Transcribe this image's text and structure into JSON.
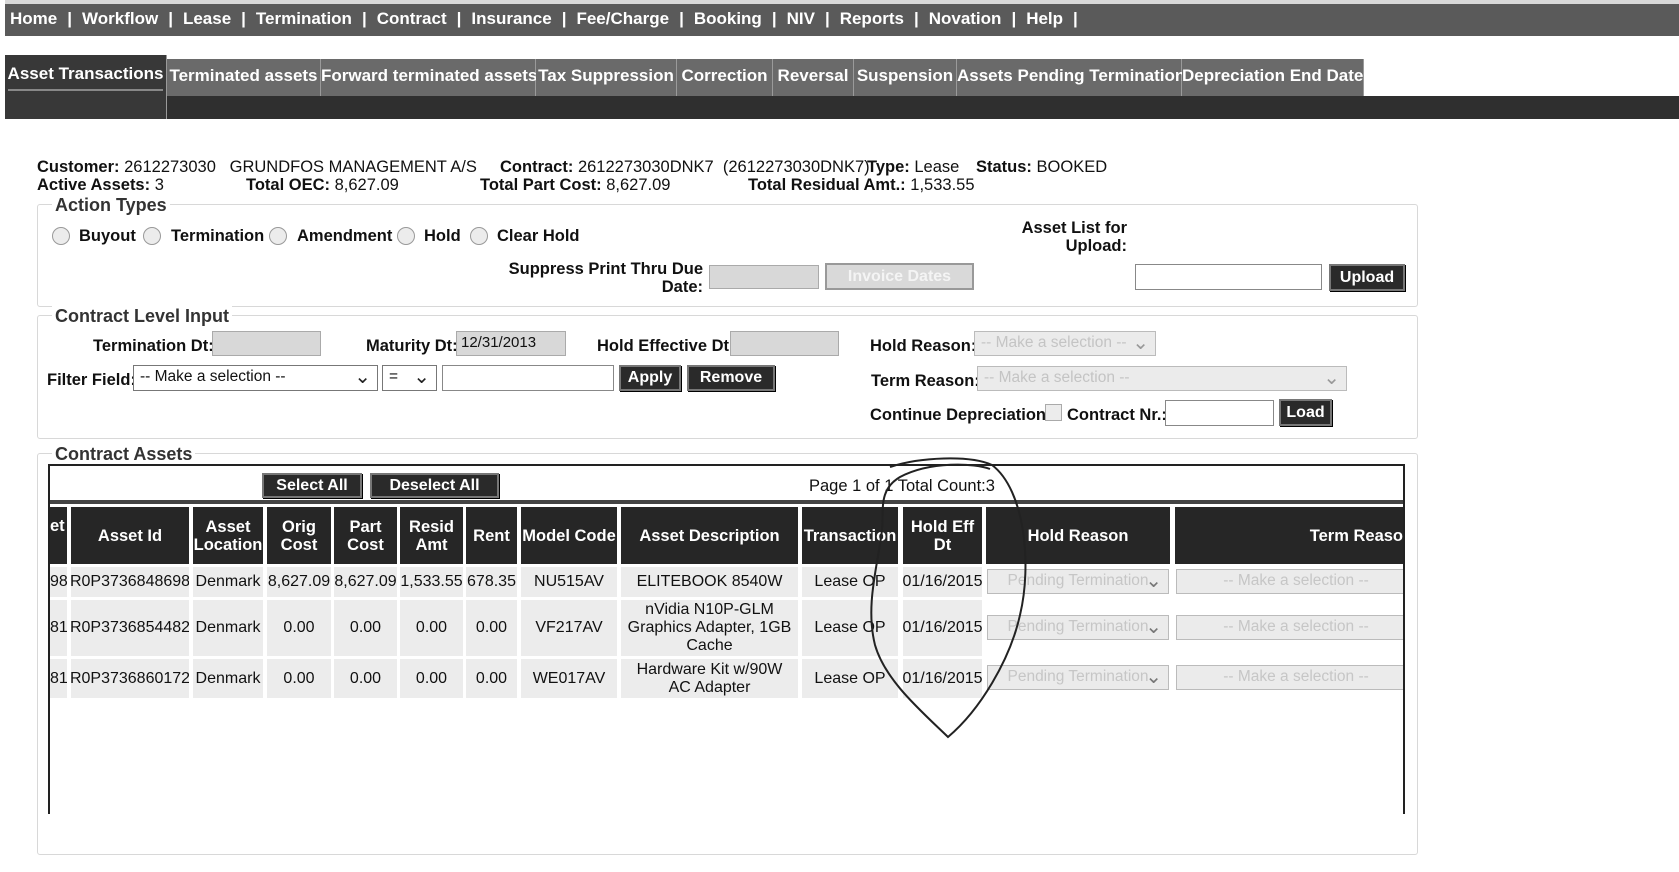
{
  "menu": [
    "Home",
    "Workflow",
    "Lease",
    "Termination",
    "Contract",
    "Insurance",
    "Fee/Charge",
    "Booking",
    "NIV",
    "Reports",
    "Novation",
    "Help"
  ],
  "tabs": [
    "Asset Transactions",
    "Terminated assets",
    "Forward terminated assets",
    "Tax Suppression",
    "Correction",
    "Reversal",
    "Suspension",
    "Assets Pending Termination",
    "Depreciation End Date"
  ],
  "info": {
    "customer_label": "Customer:",
    "customer_value": "2612273030   GRUNDFOS MANAGEMENT A/S",
    "contract_label": "Contract:",
    "contract_value": "2612273030DNK7  (2612273030DNK7)",
    "type_label": "Type:",
    "type_value": "Lease",
    "status_label": "Status:",
    "status_value": "BOOKED",
    "active_label": "Active Assets:",
    "active_value": "3",
    "oec_label": "Total OEC:",
    "oec_value": "8,627.09",
    "partcost_label": "Total Part Cost:",
    "partcost_value": "8,627.09",
    "residual_label": "Total Residual Amt.:",
    "residual_value": "1,533.55"
  },
  "action_types": {
    "legend": "Action Types",
    "options": [
      "Buyout",
      "Termination",
      "Amendment",
      "Hold",
      "Clear Hold"
    ],
    "suppress_label_1": "Suppress Print Thru Due",
    "suppress_label_2": "Date:",
    "invoice_dates_button": "Invoice Dates",
    "asset_list_label_1": "Asset List for",
    "asset_list_label_2": "Upload:",
    "upload_button": "Upload"
  },
  "contract_level": {
    "legend": "Contract Level Input",
    "termination_dt_label": "Termination Dt:",
    "maturity_dt_label": "Maturity Dt:",
    "maturity_dt_value": "12/31/2013",
    "hold_effective_label": "Hold Effective Dt:",
    "hold_reason_label": "Hold Reason:",
    "hold_reason_value": "-- Make a selection --",
    "filter_field_label": "Filter Field:",
    "filter_field_value": "-- Make a selection --",
    "operator_value": "=",
    "apply_button": "Apply",
    "remove_button": "Remove",
    "term_reason_label": "Term Reason:",
    "term_reason_value": "-- Make a selection --",
    "continue_depr_label": "Continue Depreciation",
    "contract_nr_label": "Contract Nr.:",
    "load_button": "Load"
  },
  "contract_assets": {
    "legend": "Contract Assets",
    "select_all": "Select All",
    "deselect_all": "Deselect All",
    "paging": "Page 1 of 1 Total Count:3",
    "columns": [
      "et",
      "Asset Id",
      "Asset Location",
      "Orig Cost",
      "Part Cost",
      "Resid Amt",
      "Rent",
      "Model Code",
      "Asset Description",
      "Transaction",
      "Hold Eff Dt",
      "Hold Reason",
      "Term Reaso"
    ],
    "rows": [
      {
        "c0": "98",
        "asset_id": "R0P3736848698",
        "location": "Denmark",
        "orig_cost": "8,627.09",
        "part_cost": "8,627.09",
        "resid_amt": "1,533.55",
        "rent": "678.35",
        "model_code": "NU515AV",
        "description": "ELITEBOOK 8540W",
        "transaction": "Lease OP",
        "hold_eff_dt": "01/16/2015",
        "hold_reason": "Pending Termination",
        "term_reason": "-- Make a selection --"
      },
      {
        "c0": "81",
        "asset_id": "R0P3736854482",
        "location": "Denmark",
        "orig_cost": "0.00",
        "part_cost": "0.00",
        "resid_amt": "0.00",
        "rent": "0.00",
        "model_code": "VF217AV",
        "description": "nVidia N10P-GLM Graphics Adapter, 1GB Cache",
        "transaction": "Lease OP",
        "hold_eff_dt": "01/16/2015",
        "hold_reason": "Pending Termination",
        "term_reason": "-- Make a selection --"
      },
      {
        "c0": "81",
        "asset_id": "R0P3736860172",
        "location": "Denmark",
        "orig_cost": "0.00",
        "part_cost": "0.00",
        "resid_amt": "0.00",
        "rent": "0.00",
        "model_code": "WE017AV",
        "description": "Hardware Kit w/90W AC Adapter",
        "transaction": "Lease OP",
        "hold_eff_dt": "01/16/2015",
        "hold_reason": "Pending Termination",
        "term_reason": "-- Make a selection --"
      }
    ]
  },
  "colors": {
    "menu_bg": "#5a5a5a",
    "tab_bg": "#6a6a6a",
    "tab_active_bg": "#383838",
    "header_bg": "#262626",
    "row_bg": "#ececec"
  },
  "icons": {
    "select_arrow": "chevron-down-icon",
    "annotation": "hand-drawn-circle"
  }
}
